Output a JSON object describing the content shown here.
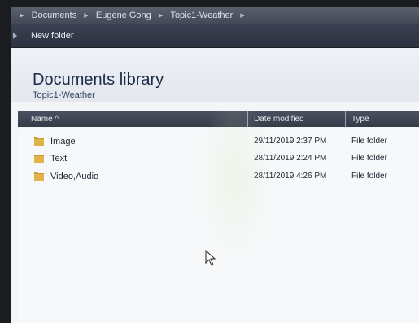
{
  "breadcrumb": {
    "items": [
      "Documents",
      "Eugene Gong",
      "Topic1-Weather"
    ]
  },
  "toolbar": {
    "new_folder_label": "New folder"
  },
  "library": {
    "title": "Documents library",
    "subtitle": "Topic1-Weather"
  },
  "columns": {
    "name": "Name",
    "date_modified": "Date modified",
    "type": "Type"
  },
  "files": [
    {
      "name": "Image",
      "date": "29/11/2019 2:37 PM",
      "type": "File folder"
    },
    {
      "name": "Text",
      "date": "28/11/2019 2:24 PM",
      "type": "File folder"
    },
    {
      "name": "Video,Audio",
      "date": "28/11/2019 4:26 PM",
      "type": "File folder"
    }
  ],
  "colors": {
    "folder_icon": "#c99a36",
    "header_bar": "#3a4152",
    "title_text": "#1b2a48"
  },
  "icons": {
    "folder": "folder-icon",
    "cursor": "mouse-cursor-icon"
  }
}
